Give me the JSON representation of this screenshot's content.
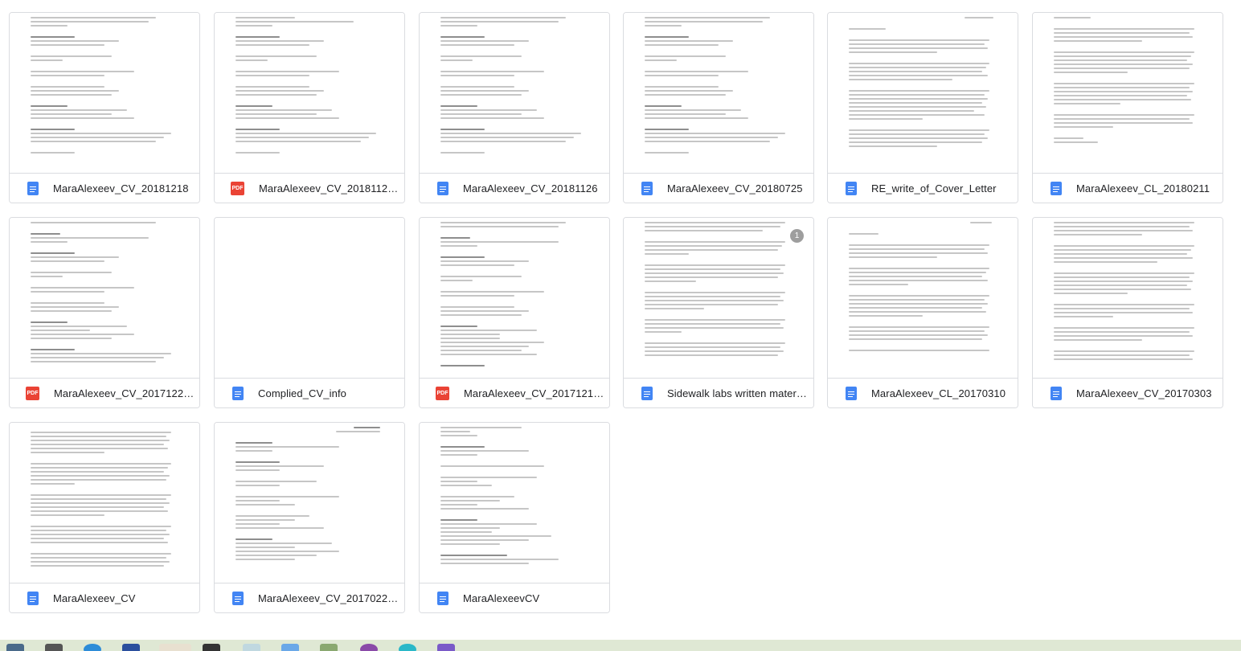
{
  "files": [
    {
      "name": "MaraAlexeev_CV_20181218",
      "type": "doc"
    },
    {
      "name": "MaraAlexeev_CV_2018112…",
      "type": "pdf"
    },
    {
      "name": "MaraAlexeev_CV_20181126",
      "type": "doc"
    },
    {
      "name": "MaraAlexeev_CV_20180725",
      "type": "doc"
    },
    {
      "name": "RE_write_of_Cover_Letter",
      "type": "doc"
    },
    {
      "name": "MaraAlexeev_CL_20180211",
      "type": "doc"
    },
    {
      "name": "MaraAlexeev_CV_2017122…",
      "type": "pdf"
    },
    {
      "name": "Complied_CV_info",
      "type": "doc"
    },
    {
      "name": "MaraAlexeev_CV_2017121…",
      "type": "pdf"
    },
    {
      "name": "Sidewalk labs written mater…",
      "type": "doc",
      "comment_count": "1"
    },
    {
      "name": "MaraAlexeev_CL_20170310",
      "type": "doc"
    },
    {
      "name": "MaraAlexeev_CV_20170303",
      "type": "doc"
    },
    {
      "name": "MaraAlexeev_CV",
      "type": "doc"
    },
    {
      "name": "MaraAlexeev_CV_2017022…",
      "type": "doc"
    },
    {
      "name": "MaraAlexeevCV",
      "type": "doc"
    }
  ],
  "pdf_label": "PDF",
  "colors": {
    "doc": "#4285f4",
    "pdf": "#ea4335",
    "taskbar": "#dfe8d4"
  }
}
